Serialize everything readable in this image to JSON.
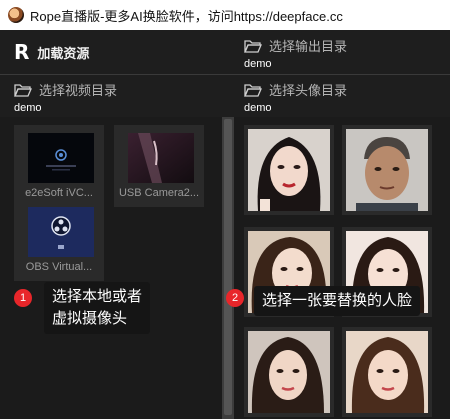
{
  "window": {
    "title": "Rope直播版-更多AI换脸软件，访问https://deepface.cc",
    "icon": "rope-app-icon"
  },
  "header": {
    "logo": "R",
    "load_models_label": "加载资源"
  },
  "output_dir": {
    "label": "选择输出目录",
    "value": "demo",
    "icon": "folder-open-icon"
  },
  "video_dir": {
    "label": "选择视频目录",
    "value": "demo",
    "icon": "folder-open-icon"
  },
  "face_dir": {
    "label": "选择头像目录",
    "value": "demo",
    "icon": "folder-open-icon"
  },
  "cameras": [
    {
      "label": "e2eSoft iVC..."
    },
    {
      "label": "USB Camera2..."
    },
    {
      "label": "OBS Virtual..."
    }
  ],
  "faces": [
    {
      "name": "face-1"
    },
    {
      "name": "face-2"
    },
    {
      "name": "face-3"
    },
    {
      "name": "face-4"
    },
    {
      "name": "face-5"
    },
    {
      "name": "face-6"
    }
  ],
  "annotations": [
    {
      "number": "1",
      "text_line1": "选择本地或者",
      "text_line2": "虚拟摄像头"
    },
    {
      "number": "2",
      "text": "选择一张要替换的人脸"
    }
  ],
  "colors": {
    "badge": "#e8262a",
    "background": "#1b1b1b"
  }
}
